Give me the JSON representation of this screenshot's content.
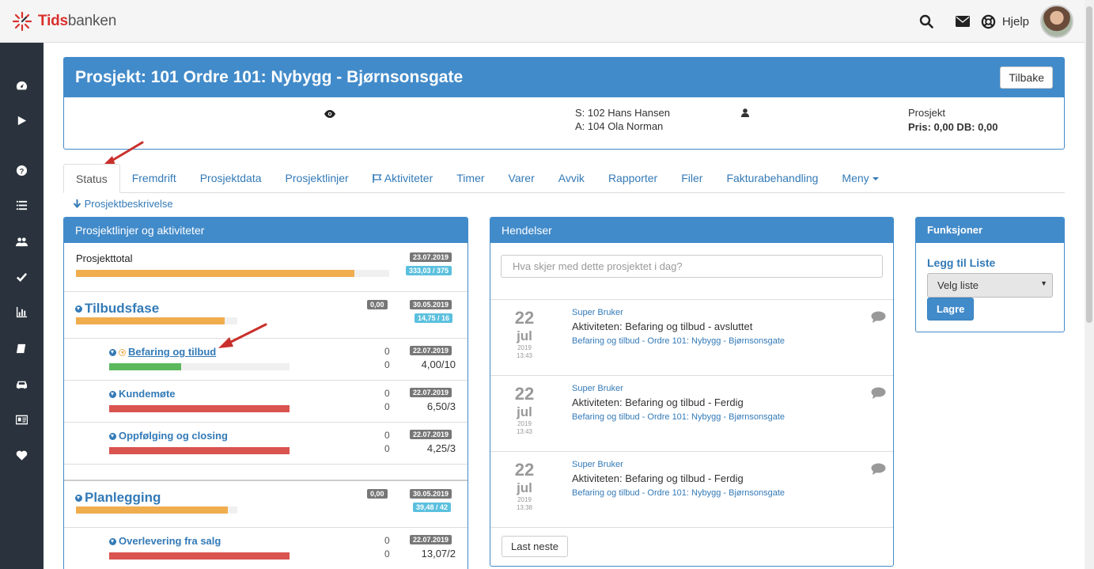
{
  "app": {
    "logo_bold": "Tids",
    "logo_rest": "banken",
    "help_label": "Hjelp"
  },
  "sidebar": {
    "items": [
      {
        "name": "dashboard-icon"
      },
      {
        "name": "play-icon"
      },
      {
        "name": "question-icon"
      },
      {
        "name": "list-icon"
      },
      {
        "name": "users-icon"
      },
      {
        "name": "check-icon"
      },
      {
        "name": "bar-chart-icon"
      },
      {
        "name": "book-icon"
      },
      {
        "name": "car-icon"
      },
      {
        "name": "id-card-icon"
      },
      {
        "name": "heart-icon"
      }
    ]
  },
  "project": {
    "title": "Prosjekt: 101 Ordre 101: Nybygg - Bjørnsonsgate",
    "back_label": "Tilbake",
    "s_person": "S: 102 Hans Hansen",
    "a_person": "A: 104 Ola Norman",
    "type": "Prosjekt",
    "price": "Pris: 0,00 DB: 0,00"
  },
  "tabs": [
    {
      "label": "Status",
      "active": true
    },
    {
      "label": "Fremdrift"
    },
    {
      "label": "Prosjektdata"
    },
    {
      "label": "Prosjektlinjer"
    },
    {
      "label": "Aktiviteter"
    },
    {
      "label": "Timer"
    },
    {
      "label": "Varer"
    },
    {
      "label": "Avvik"
    },
    {
      "label": "Rapporter"
    },
    {
      "label": "Filer"
    },
    {
      "label": "Fakturabehandling"
    },
    {
      "label": "Meny"
    }
  ],
  "description_link": "Prosjektbeskrivelse",
  "lines_panel": {
    "title": "Prosjektlinjer og aktiviteter",
    "total": {
      "label": "Prosjekttotal",
      "date": "23.07.2019",
      "hours": "333,03 / 375",
      "progress": 0.89
    },
    "phases": [
      {
        "label": "Tilbudsfase",
        "amount": "0,00",
        "date": "30.05.2019",
        "hours": "14,75 / 16",
        "progress": 0.92,
        "activities": [
          {
            "label": "Befaring og tilbud",
            "count1": "0",
            "count2": "0",
            "date": "22.07.2019",
            "hours": "4,00/10",
            "progress": 0.4,
            "color": "green"
          },
          {
            "label": "Kundemøte",
            "count1": "0",
            "count2": "0",
            "date": "22.07.2019",
            "hours": "6,50/3",
            "progress": 1,
            "color": "red"
          },
          {
            "label": "Oppfølging og closing",
            "count1": "0",
            "count2": "0",
            "date": "22.07.2019",
            "hours": "4,25/3",
            "progress": 1,
            "color": "red"
          }
        ]
      },
      {
        "label": "Planlegging",
        "amount": "0,00",
        "date": "30.05.2019",
        "hours": "39,48 / 42",
        "progress": 0.94,
        "activities": [
          {
            "label": "Overlevering fra salg",
            "count1": "0",
            "count2": "0",
            "date": "22.07.2019",
            "hours": "13,07/2",
            "progress": 1,
            "color": "red"
          }
        ]
      }
    ]
  },
  "events_panel": {
    "title": "Hendelser",
    "input_placeholder": "Hva skjer med dette prosjektet i dag?",
    "more_label": "Last neste",
    "events": [
      {
        "day": "22",
        "month": "jul",
        "year": "2019",
        "time": "13:43",
        "user": "Super Bruker",
        "text": "Aktiviteten: Befaring og tilbud - avsluttet",
        "link": "Befaring og tilbud - Ordre 101: Nybygg - Bjørnsonsgate"
      },
      {
        "day": "22",
        "month": "jul",
        "year": "2019",
        "time": "13:43",
        "user": "Super Bruker",
        "text": "Aktiviteten: Befaring og tilbud - Ferdig",
        "link": "Befaring og tilbud - Ordre 101: Nybygg - Bjørnsonsgate"
      },
      {
        "day": "22",
        "month": "jul",
        "year": "2019",
        "time": "13:38",
        "user": "Super Bruker",
        "text": "Aktiviteten: Befaring og tilbud - Ferdig",
        "link": "Befaring og tilbud - Ordre 101: Nybygg - Bjørnsonsgate"
      }
    ]
  },
  "functions_panel": {
    "title": "Funksjoner",
    "add_label": "Legg til Liste",
    "select_value": "Velg liste",
    "save_label": "Lagre"
  },
  "colors": {
    "primary": "#428bca",
    "link": "#337ab7",
    "sidebar": "#2a333d",
    "orange": "#f0ad4e",
    "green": "#5cb85c",
    "red": "#d9534f",
    "annotation": "#c9302c"
  }
}
